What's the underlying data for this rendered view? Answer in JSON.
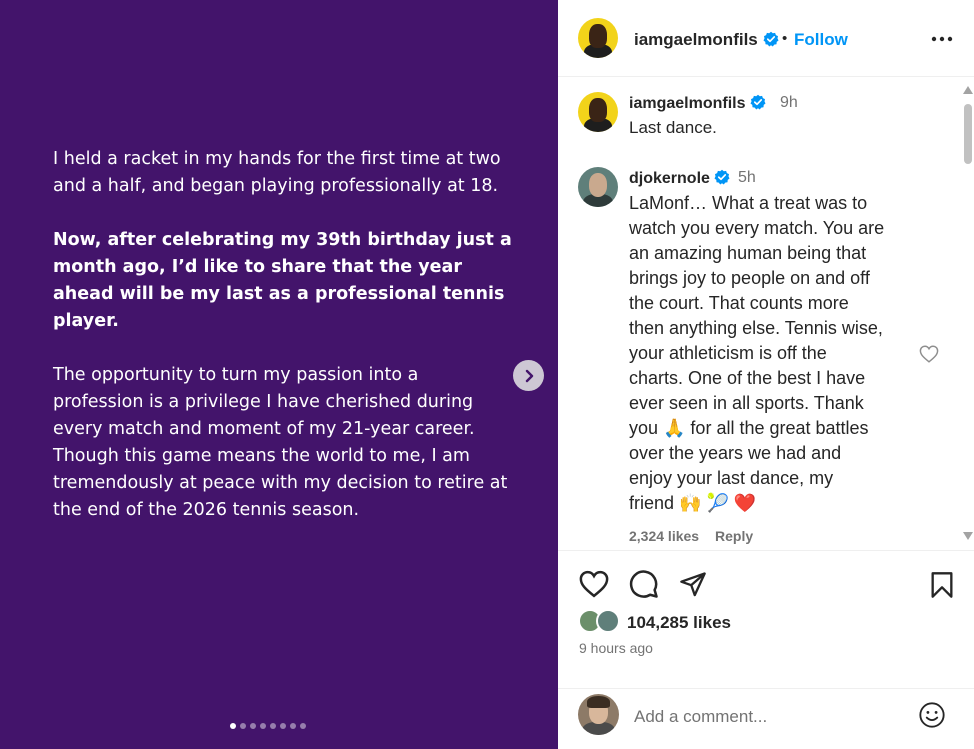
{
  "post": {
    "paragraphs": [
      {
        "text": "I held a racket in my hands for the first time at two and a half, and began playing professionally at 18.",
        "bold": false
      },
      {
        "text": "Now, after celebrating my 39th birthday just a month ago, I’d like to share that the year ahead will be my last as a professional tennis player.",
        "bold": true
      },
      {
        "text": "The opportunity to turn my passion into a profession is a privilege I have cherished during every match and moment of my 21-year career. Though this game means the world to me, I am tremendously at peace with my decision to retire at the end of the 2026 tennis season.",
        "bold": false
      }
    ],
    "carousel": {
      "total": 8,
      "active": 0
    }
  },
  "header": {
    "username": "iamgaelmonfils",
    "separator": "•",
    "follow_label": "Follow"
  },
  "caption": {
    "username": "iamgaelmonfils",
    "time": "9h",
    "text": "Last dance."
  },
  "comment": {
    "username": "djokernole",
    "time": "5h",
    "lines": [
      "LaMonf… What a treat was to",
      "watch you every match. You are",
      "an amazing human being that",
      "brings joy to people on and off",
      "the court. That counts more",
      "then anything else. Tennis wise,",
      "your athleticism is off the",
      "charts. One of the best I have",
      "ever seen in all sports. Thank",
      "you 🙏 for all the great battles",
      "over the years we had and",
      "enjoy your last dance, my",
      "friend 🙌 🎾 ❤️"
    ],
    "likes": "2,324 likes",
    "reply_label": "Reply"
  },
  "engagement": {
    "likes": "104,285 likes",
    "time_ago": "9 hours ago"
  },
  "composer": {
    "placeholder": "Add a comment..."
  },
  "colors": {
    "post_bg": "#43146b",
    "accent": "#0095f6",
    "verified": "#0095f6"
  }
}
